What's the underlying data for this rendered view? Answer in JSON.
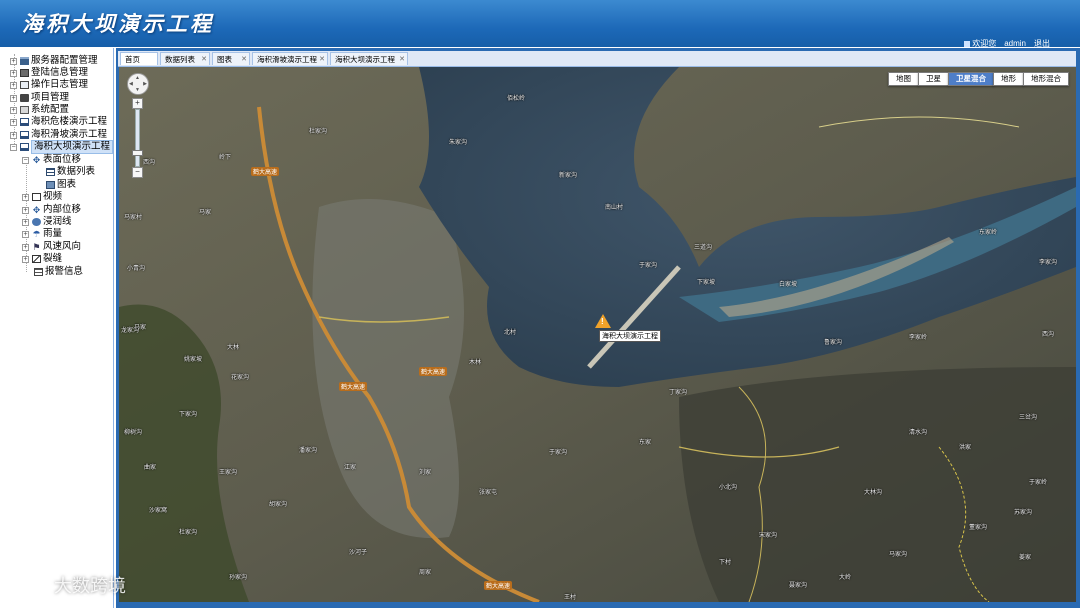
{
  "app": {
    "title": "海积大坝演示工程"
  },
  "userbar": {
    "welcome": "欢迎您",
    "user": "admin",
    "logout": "退出"
  },
  "sidebar": {
    "items": [
      {
        "label": "服务器配置管理"
      },
      {
        "label": "登陆信息管理"
      },
      {
        "label": "操作日志管理"
      },
      {
        "label": "项目管理"
      },
      {
        "label": "系统配置"
      },
      {
        "label": "海积危楼演示工程"
      },
      {
        "label": "海积滑坡演示工程"
      },
      {
        "label": "海积大坝演示工程"
      },
      {
        "label": "表面位移"
      },
      {
        "label": "数据列表"
      },
      {
        "label": "图表"
      },
      {
        "label": "视频"
      },
      {
        "label": "内部位移"
      },
      {
        "label": "浸润线"
      },
      {
        "label": "雨量"
      },
      {
        "label": "风速风向"
      },
      {
        "label": "裂缝"
      },
      {
        "label": "报警信息"
      }
    ]
  },
  "tabs": [
    {
      "label": "首页",
      "closable": false
    },
    {
      "label": "数据列表",
      "closable": true
    },
    {
      "label": "图表",
      "closable": true
    },
    {
      "label": "海积滑坡演示工程",
      "closable": true
    },
    {
      "label": "海积大坝演示工程",
      "closable": true
    }
  ],
  "map": {
    "types": [
      "地图",
      "卫星",
      "卫星混合",
      "地形",
      "地形混合"
    ],
    "active_type": "卫星混合",
    "marker_label": "海积大坝演示工程",
    "roads": [
      "鹤大高速",
      "鹤大高速",
      "鹤大高速",
      "鹤大高速"
    ],
    "places": [
      "佰松岭",
      "杜家沟",
      "岭下",
      "朱家沟",
      "西沟",
      "新家沟",
      "马家村",
      "马家",
      "小青沟",
      "南山村",
      "于家沟",
      "北村",
      "三道沟",
      "下家坡",
      "白家坡",
      "马家",
      "姚家坡",
      "大林",
      "东家岭",
      "李家沟",
      "西沟",
      "鲁家沟",
      "李家岭",
      "三岔沟",
      "花家沟",
      "下家沟",
      "龙家沟",
      "柳树沟",
      "曲家",
      "沙家窝",
      "杜家沟",
      "王家沟",
      "孙家沟",
      "潘家沟",
      "于家沟",
      "东家",
      "小北沟",
      "宋家沟",
      "大林沟",
      "马家沟",
      "董家沟",
      "苏家沟",
      "聂家沟",
      "大岭",
      "清水沟",
      "丁家沟",
      "于家岭",
      "洪家",
      "下村",
      "刘家",
      "江家",
      "张家屯",
      "王村",
      "周家",
      "沙河子",
      "胡家沟",
      "姜家",
      "木林"
    ],
    "watermark": "大数跨境"
  }
}
